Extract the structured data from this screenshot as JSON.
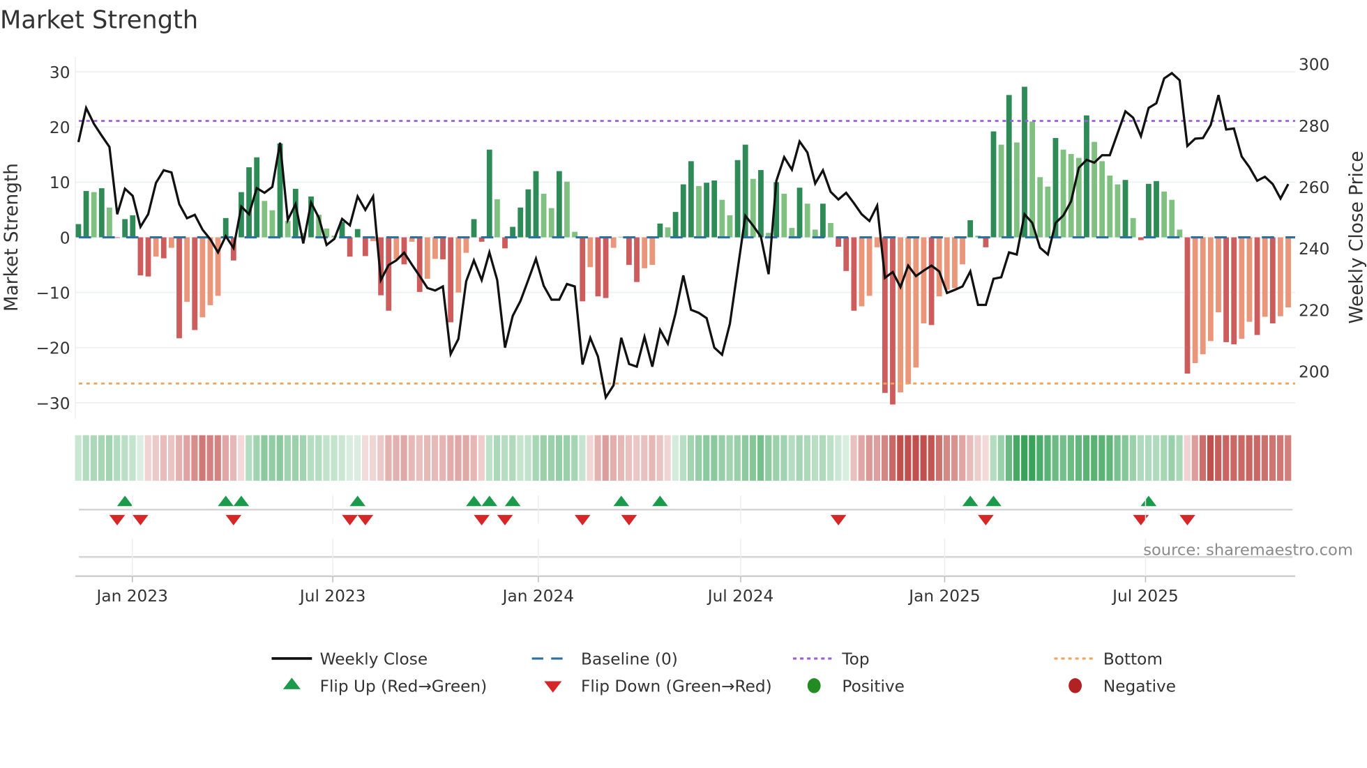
{
  "title": "Market Strength",
  "source": "source: sharemaestro.com",
  "colors": {
    "bar_pos_strong": "#2e8b57",
    "bar_pos_weak": "#80c080",
    "bar_neg_strong": "#cd5c5c",
    "bar_neg_weak": "#e9967a",
    "close_line": "#111111",
    "baseline": "#2f6f9f",
    "top": "#9a5fd6",
    "bottom": "#f0a460",
    "flip_up": "#1a9a4a",
    "flip_down": "#d62728",
    "positive": "#228b22",
    "negative": "#b22222",
    "strip_pos": "#3aa35a",
    "strip_neg": "#c0504d"
  },
  "legend": [
    {
      "key": "weekly_close",
      "label": "Weekly Close"
    },
    {
      "key": "baseline",
      "label": "Baseline (0)"
    },
    {
      "key": "top",
      "label": "Top"
    },
    {
      "key": "bottom",
      "label": "Bottom"
    },
    {
      "key": "flip_up",
      "label": "Flip Up (Red→Green)"
    },
    {
      "key": "flip_down",
      "label": "Flip Down (Green→Red)"
    },
    {
      "key": "positive",
      "label": "Positive"
    },
    {
      "key": "negative",
      "label": "Negative"
    }
  ],
  "chart_data": {
    "type": "bar",
    "title": "Market Strength",
    "ylabel": "Market Strength",
    "y2label": "Weekly Close Price",
    "ylim": [
      -33,
      33
    ],
    "y2lim": [
      187,
      304
    ],
    "yticks": [
      30,
      20,
      10,
      0,
      -10,
      -20,
      -30
    ],
    "ytick_labels": [
      "30",
      "20",
      "10",
      "0",
      "−10",
      "−20",
      "−30"
    ],
    "y2ticks": [
      300,
      280,
      260,
      240,
      220,
      200
    ],
    "y2tick_labels": [
      "300",
      "280",
      "260",
      "240",
      "220",
      "200"
    ],
    "xticks": [
      {
        "label": "Jan 2023",
        "week": 6.95
      },
      {
        "label": "Jul 2023",
        "week": 32.8
      },
      {
        "label": "Jan 2024",
        "week": 59.3
      },
      {
        "label": "Jul 2024",
        "week": 85.4
      },
      {
        "label": "Jan 2025",
        "week": 111.7
      },
      {
        "label": "Jul 2025",
        "week": 137.6
      }
    ],
    "top_level": 21.1,
    "bottom_level": -26.5,
    "baseline": 0,
    "grid": true,
    "legend_position": "bottom",
    "strength": [
      2.4,
      8.4,
      8.2,
      8.9,
      5.4,
      -0.1,
      3.3,
      4.0,
      -6.9,
      -7.1,
      -3.5,
      -3.8,
      -1.9,
      -18.3,
      -11.7,
      -16.8,
      -14.5,
      -12.3,
      -10.6,
      3.5,
      -4.2,
      8.2,
      12.7,
      14.5,
      6.6,
      4.9,
      17.0,
      3.0,
      8.8,
      0.8,
      7.4,
      4.1,
      1.6,
      0.3,
      2.8,
      -3.5,
      1.5,
      -3.4,
      -0.7,
      -10.5,
      -13.3,
      -4.0,
      -4.9,
      -0.8,
      -9.9,
      -7.5,
      -3.9,
      -4.0,
      -15.4,
      -10.0,
      -2.8,
      3.3,
      -0.8,
      15.9,
      6.9,
      -2.0,
      1.9,
      5.4,
      8.7,
      12.0,
      7.9,
      5.3,
      12.0,
      10.1,
      1.0,
      -11.6,
      -5.4,
      -10.7,
      -11.0,
      -1.9,
      0.1,
      -5.0,
      -8.1,
      -5.6,
      -5.0,
      2.5,
      1.8,
      4.6,
      9.6,
      13.8,
      9.3,
      9.9,
      10.3,
      6.8,
      4.0,
      14.0,
      16.8,
      10.6,
      12.2,
      0.8,
      10.0,
      7.9,
      1.7,
      9.0,
      6.1,
      1.4,
      6.1,
      2.6,
      -1.7,
      -6.1,
      -13.3,
      -12.5,
      -10.6,
      -1.8,
      -28.2,
      -30.3,
      -28.1,
      -26.6,
      -23.6,
      -15.6,
      -15.9,
      -10.7,
      -9.5,
      -9.2,
      -4.9,
      3.1,
      0.3,
      -1.8,
      19.2,
      16.8,
      25.8,
      17.2,
      27.3,
      21.0,
      10.9,
      9.2,
      18.0,
      15.9,
      15.1,
      14.4,
      22.1,
      17.3,
      13.8,
      11.2,
      9.6,
      10.4,
      3.5,
      -0.5,
      9.7,
      10.2,
      8.3,
      6.8,
      1.4,
      -24.7,
      -22.8,
      -21.2,
      -18.8,
      -13.6,
      -19.0,
      -19.4,
      -18.4,
      -15.3,
      -17.7,
      -14.4,
      -15.6,
      -14.3,
      -12.7
    ],
    "strong": [
      1,
      1,
      0,
      1,
      0,
      1,
      1,
      1,
      1,
      1,
      0,
      1,
      0,
      1,
      0,
      1,
      0,
      0,
      0,
      1,
      1,
      1,
      1,
      1,
      0,
      0,
      1,
      0,
      1,
      0,
      1,
      0,
      0,
      0,
      1,
      1,
      1,
      1,
      0,
      1,
      1,
      0,
      1,
      0,
      1,
      0,
      0,
      1,
      1,
      0,
      0,
      1,
      1,
      1,
      0,
      1,
      1,
      1,
      1,
      1,
      0,
      0,
      1,
      0,
      0,
      1,
      0,
      1,
      1,
      0,
      0,
      1,
      1,
      0,
      0,
      1,
      0,
      1,
      1,
      1,
      0,
      1,
      1,
      0,
      0,
      1,
      1,
      0,
      1,
      0,
      1,
      0,
      0,
      1,
      0,
      0,
      1,
      0,
      1,
      1,
      1,
      0,
      0,
      0,
      1,
      1,
      0,
      0,
      0,
      0,
      1,
      0,
      0,
      0,
      0,
      1,
      0,
      1,
      1,
      0,
      1,
      0,
      1,
      0,
      0,
      0,
      1,
      0,
      0,
      0,
      1,
      0,
      0,
      0,
      0,
      1,
      0,
      1,
      1,
      1,
      0,
      0,
      0,
      1,
      0,
      0,
      0,
      0,
      1,
      1,
      0,
      0,
      1,
      0,
      1,
      0,
      0
    ],
    "close": [
      274.6,
      285.7,
      280.5,
      276.7,
      273.0,
      251.1,
      259.4,
      257.1,
      247.0,
      251.1,
      261.3,
      265.4,
      264.7,
      254.4,
      249.8,
      250.9,
      246.1,
      243.0,
      238.7,
      244.0,
      240.1,
      253.6,
      251.1,
      259.6,
      258.1,
      260.0,
      274.4,
      249.2,
      254.4,
      241.6,
      254.9,
      250.0,
      241.1,
      243.1,
      249.6,
      247.5,
      256.9,
      252.5,
      256.9,
      229.7,
      234.6,
      236.1,
      238.6,
      234.7,
      231.0,
      227.1,
      226.3,
      227.6,
      205.6,
      210.5,
      229.3,
      236.1,
      229.7,
      238.7,
      229.7,
      207.7,
      218.0,
      222.9,
      229.7,
      236.6,
      227.8,
      223.3,
      223.3,
      228.4,
      227.6,
      202.2,
      210.9,
      204.8,
      191.5,
      195.4,
      210.9,
      202.4,
      201.5,
      211.2,
      201.5,
      213.5,
      209.0,
      218.8,
      231.2,
      220.0,
      219.0,
      217.3,
      207.7,
      205.4,
      215.4,
      233.1,
      250.6,
      247.4,
      243.8,
      231.6,
      262.0,
      269.7,
      265.6,
      274.8,
      271.2,
      261.1,
      265.4,
      258.4,
      255.9,
      258.1,
      254.7,
      251.1,
      248.9,
      253.9,
      230.4,
      232.3,
      227.4,
      234.4,
      231.0,
      232.8,
      234.4,
      232.5,
      225.5,
      226.5,
      227.6,
      232.5,
      221.6,
      221.6,
      230.1,
      230.6,
      238.7,
      238.0,
      251.1,
      248.3,
      240.2,
      238.0,
      248.3,
      250.7,
      255.3,
      266.2,
      268.8,
      267.9,
      270.3,
      270.3,
      277.5,
      284.6,
      282.5,
      276.5,
      285.7,
      287.2,
      295.3,
      297.0,
      294.7,
      273.3,
      275.7,
      275.9,
      280.1,
      289.9,
      278.7,
      279.0,
      269.9,
      266.4,
      262.0,
      263.3,
      260.9,
      256.2,
      260.9
    ],
    "flip_up_weeks": [
      6,
      19,
      21,
      36,
      51,
      53,
      56,
      70,
      75,
      115,
      118,
      138
    ],
    "flip_down_weeks": [
      5,
      8,
      20,
      35,
      37,
      52,
      55,
      65,
      71,
      98,
      117,
      137,
      143
    ]
  }
}
